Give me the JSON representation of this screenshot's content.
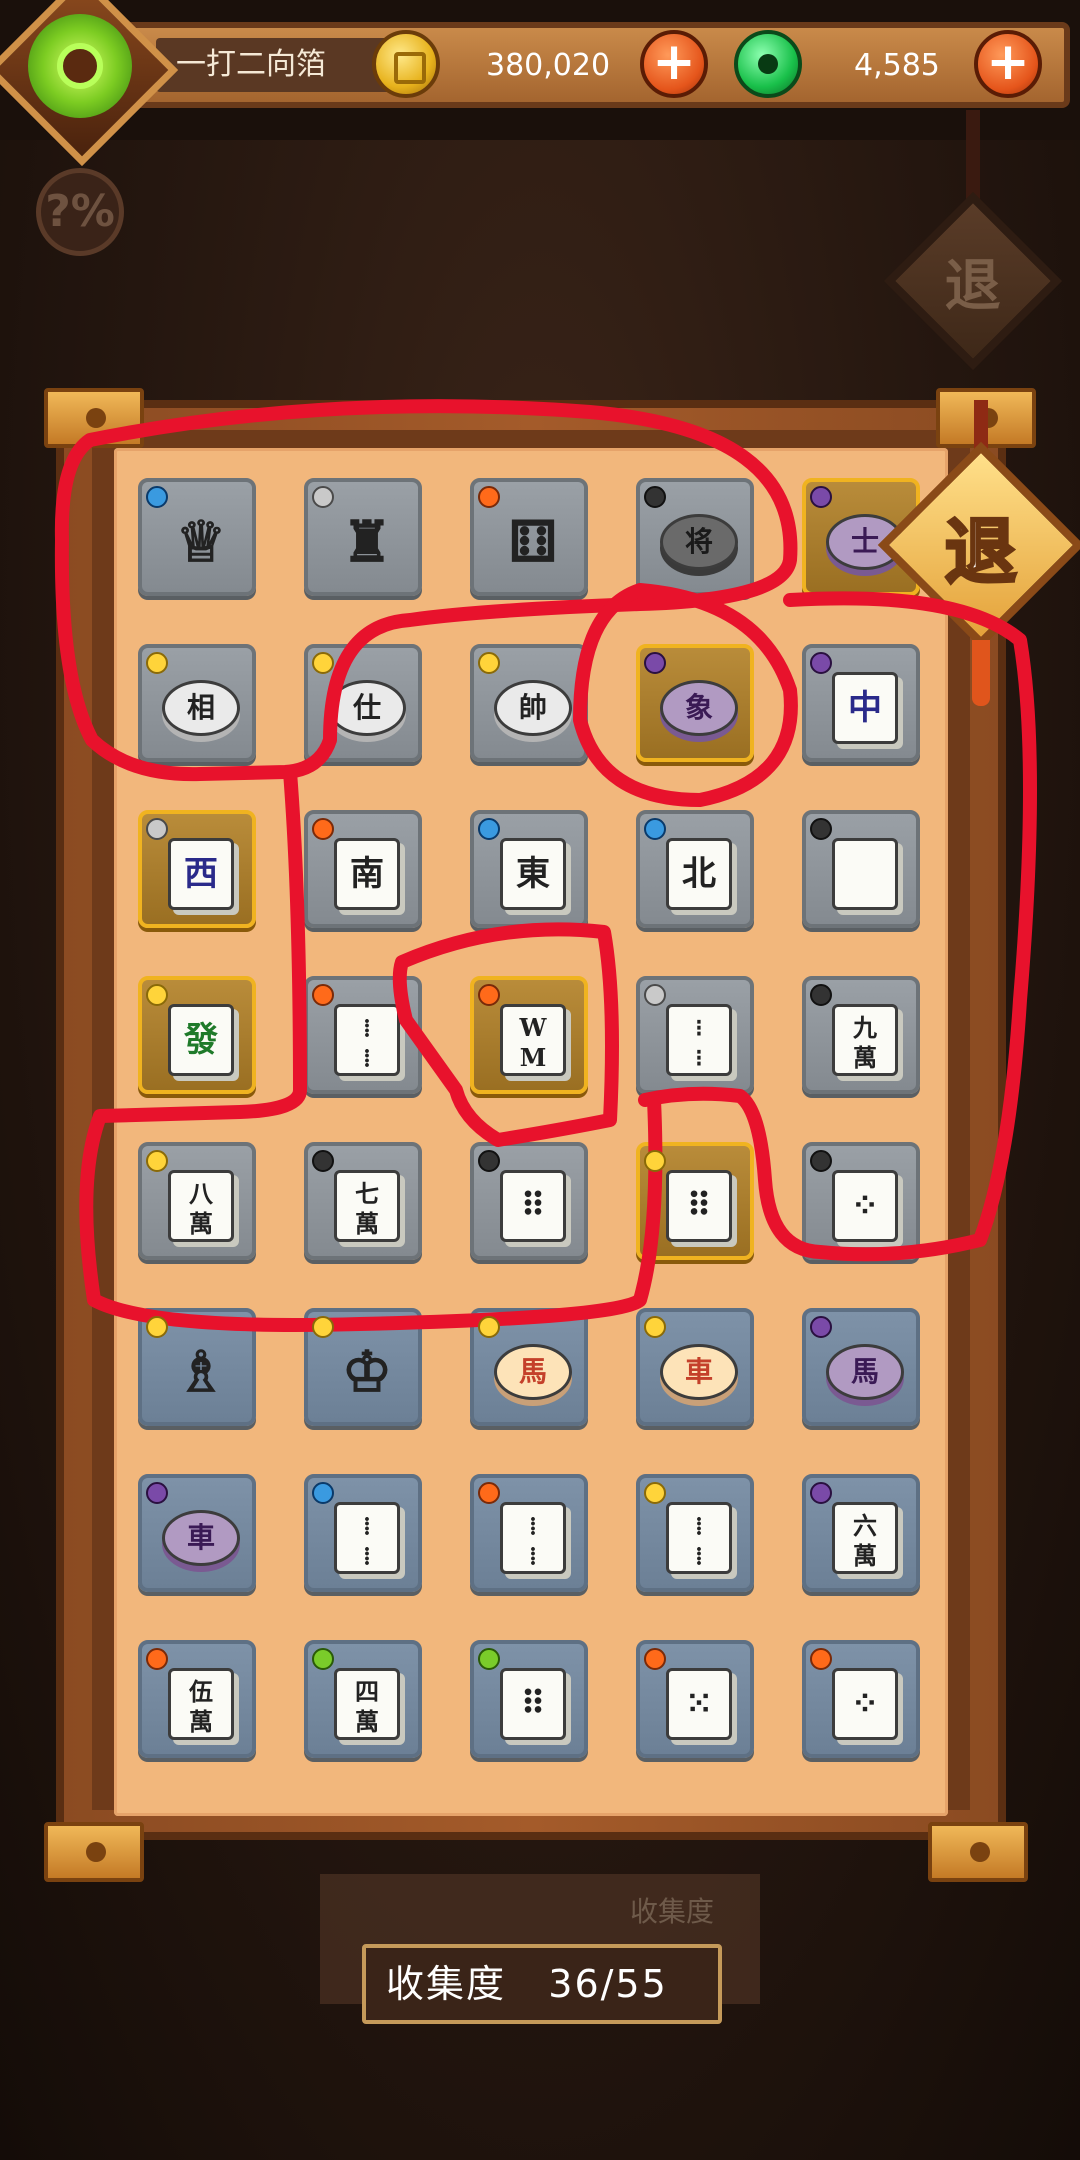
{
  "header": {
    "player_name": "一打二向箔",
    "coins": "380,020",
    "jade": "4,585",
    "plus_label": "+"
  },
  "help_button": {
    "label": "?%"
  },
  "exit_button": {
    "label": "退"
  },
  "collection": {
    "label": "收集度",
    "progress": "36/55",
    "ghost_label": "收集度"
  },
  "tiles": [
    {
      "id": "r1c1",
      "glyph": "♕",
      "style": "piece",
      "badge": "water",
      "variant": "gray"
    },
    {
      "id": "r1c2",
      "glyph": "♜",
      "style": "piece",
      "badge": "tri",
      "variant": "gray"
    },
    {
      "id": "r1c3",
      "glyph": "⚅",
      "style": "piece",
      "badge": "fire",
      "variant": "gray"
    },
    {
      "id": "r1c4",
      "glyph": "将",
      "style": "chip dark",
      "badge": "dark",
      "variant": "gray"
    },
    {
      "id": "r1c5",
      "glyph": "士",
      "style": "chip purple",
      "badge": "moon",
      "variant": "gold"
    },
    {
      "id": "r2c1",
      "glyph": "相",
      "style": "chip",
      "badge": "sun",
      "variant": "gray"
    },
    {
      "id": "r2c2",
      "glyph": "仕",
      "style": "chip",
      "badge": "sun",
      "variant": "gray"
    },
    {
      "id": "r2c3",
      "glyph": "帥",
      "style": "chip",
      "badge": "sun",
      "variant": "gray"
    },
    {
      "id": "r2c4",
      "glyph": "象",
      "style": "chip purple",
      "badge": "moon",
      "variant": "gold"
    },
    {
      "id": "r2c5",
      "glyph": "中",
      "style": "tile",
      "badge": "moon",
      "variant": "gray"
    },
    {
      "id": "r3c1",
      "glyph": "西",
      "style": "tile",
      "badge": "tri",
      "variant": "gold"
    },
    {
      "id": "r3c2",
      "glyph": "南",
      "style": "tile",
      "badge": "fire",
      "variant": "gray"
    },
    {
      "id": "r3c3",
      "glyph": "東",
      "style": "tile",
      "badge": "water",
      "variant": "gray"
    },
    {
      "id": "r3c4",
      "glyph": "北",
      "style": "tile",
      "badge": "water",
      "variant": "gray"
    },
    {
      "id": "r3c5",
      "glyph": "",
      "style": "tile",
      "badge": "dark",
      "variant": "gray"
    },
    {
      "id": "r4c1",
      "glyph": "發",
      "style": "tile",
      "badge": "sun",
      "variant": "gold"
    },
    {
      "id": "r4c2",
      "glyph": "⁞⁞",
      "style": "tile",
      "badge": "fire",
      "variant": "gray"
    },
    {
      "id": "r4c3",
      "glyph": "WM",
      "style": "tile",
      "badge": "fire",
      "variant": "gold"
    },
    {
      "id": "r4c4",
      "glyph": "⁝⁝",
      "style": "tile",
      "badge": "tri",
      "variant": "gray"
    },
    {
      "id": "r4c5",
      "glyph": "九萬",
      "style": "tile",
      "badge": "dark",
      "variant": "gray"
    },
    {
      "id": "r5c1",
      "glyph": "八萬",
      "style": "tile",
      "badge": "sun",
      "variant": "gray"
    },
    {
      "id": "r5c2",
      "glyph": "七萬",
      "style": "tile",
      "badge": "dark",
      "variant": "gray"
    },
    {
      "id": "r5c3",
      "glyph": "⠿",
      "style": "tile",
      "badge": "dark",
      "variant": "gray"
    },
    {
      "id": "r5c4",
      "glyph": "⠿",
      "style": "tile",
      "badge": "sun",
      "variant": "gold"
    },
    {
      "id": "r5c5",
      "glyph": "⁘",
      "style": "tile",
      "badge": "dark",
      "variant": "gray"
    },
    {
      "id": "r6c1",
      "glyph": "♗",
      "style": "piece",
      "badge": "sun",
      "variant": "blue"
    },
    {
      "id": "r6c2",
      "glyph": "♔",
      "style": "piece",
      "badge": "sun",
      "variant": "blue"
    },
    {
      "id": "r6c3",
      "glyph": "馬",
      "style": "chip cream",
      "badge": "sun",
      "variant": "blue"
    },
    {
      "id": "r6c4",
      "glyph": "車",
      "style": "chip cream",
      "badge": "sun",
      "variant": "blue"
    },
    {
      "id": "r6c5",
      "glyph": "馬",
      "style": "chip purple",
      "badge": "moon",
      "variant": "blue"
    },
    {
      "id": "r7c1",
      "glyph": "車",
      "style": "chip purple",
      "badge": "moon",
      "variant": "blue"
    },
    {
      "id": "r7c2",
      "glyph": "⁞⁞",
      "style": "tile",
      "badge": "water",
      "variant": "blue"
    },
    {
      "id": "r7c3",
      "glyph": "⁞⁞",
      "style": "tile",
      "badge": "fire",
      "variant": "blue"
    },
    {
      "id": "r7c4",
      "glyph": "⁞⁞",
      "style": "tile",
      "badge": "sun",
      "variant": "blue"
    },
    {
      "id": "r7c5",
      "glyph": "六萬",
      "style": "tile",
      "badge": "moon",
      "variant": "blue"
    },
    {
      "id": "r8c1",
      "glyph": "伍萬",
      "style": "tile",
      "badge": "fire",
      "variant": "blue"
    },
    {
      "id": "r8c2",
      "glyph": "四萬",
      "style": "tile",
      "badge": "leaf",
      "variant": "blue"
    },
    {
      "id": "r8c3",
      "glyph": "⠿",
      "style": "tile",
      "badge": "leaf",
      "variant": "blue"
    },
    {
      "id": "r8c4",
      "glyph": "⁙",
      "style": "tile",
      "badge": "fire",
      "variant": "blue"
    },
    {
      "id": "r8c5",
      "glyph": "⁘",
      "style": "tile",
      "badge": "fire",
      "variant": "blue"
    }
  ],
  "colors": {
    "annotation_red": "#e8122c",
    "paper": "#f2b77c",
    "frame": "#a45b2a",
    "gold_border": "#f0b320"
  }
}
